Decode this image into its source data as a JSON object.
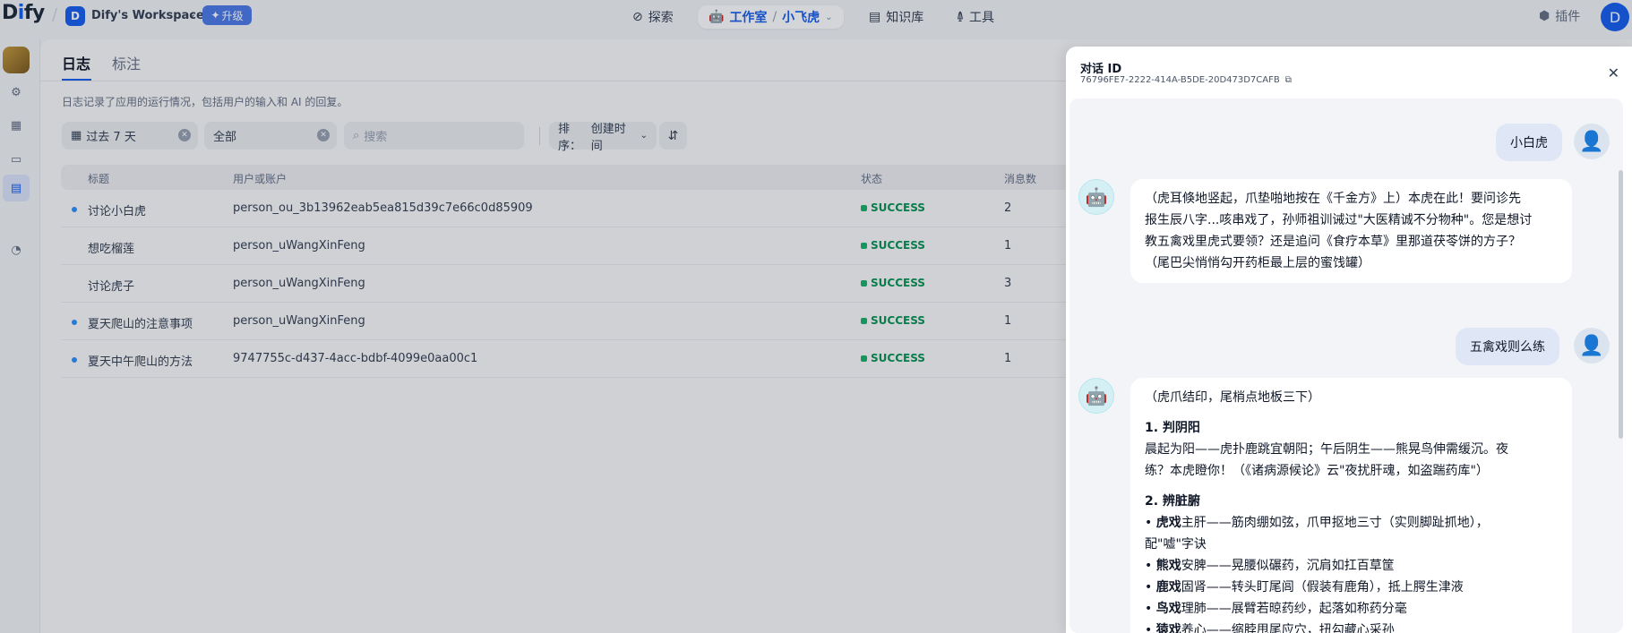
{
  "topbar": {
    "logo_prefix": "D",
    "logo_i": "i",
    "logo_suffix": "fy",
    "workspace_initial": "D",
    "workspace_name": "Dify's Workspace",
    "upgrade_label": "升级",
    "nav": {
      "explore": "探索",
      "studio": "工作室",
      "app": "小飞虎",
      "knowledge": "知识库",
      "tools": "工具"
    },
    "plugins": "插件",
    "user_initial": "D"
  },
  "main": {
    "tabs": [
      "日志",
      "标注"
    ],
    "description": "日志记录了应用的运行情况，包括用户的输入和 AI 的回复。",
    "filters": {
      "period": "过去 7 天",
      "status": "全部",
      "search_placeholder": "搜索",
      "sort_label": "排序：",
      "sort_value": "创建时间"
    },
    "columns": [
      "标题",
      "用户或账户",
      "状态",
      "消息数"
    ],
    "rows": [
      {
        "title": "讨论小白虎",
        "user": "person_ou_3b13962eab5ea815d39c7e66c0d85909",
        "status": "SUCCESS",
        "count": "2",
        "unread": true
      },
      {
        "title": "想吃榴莲",
        "user": "person_uWangXinFeng",
        "status": "SUCCESS",
        "count": "1",
        "unread": false
      },
      {
        "title": "讨论虎子",
        "user": "person_uWangXinFeng",
        "status": "SUCCESS",
        "count": "3",
        "unread": false
      },
      {
        "title": "夏天爬山的注意事项",
        "user": "person_uWangXinFeng",
        "status": "SUCCESS",
        "count": "1",
        "unread": true
      },
      {
        "title": "夏天中午爬山的方法",
        "user": "9747755c-d437-4acc-bdbf-4099e0aa00c1",
        "status": "SUCCESS",
        "count": "1",
        "unread": true
      }
    ]
  },
  "panel": {
    "title": "对话 ID",
    "conversation_id": "76796FE7-2222-414A-B5DE-20D473D7CAFB",
    "messages": {
      "user1": "小白虎",
      "bot1": [
        "（虎耳倏地竖起，爪垫啪地按在《千金方》上）本虎在此！要问诊先",
        "报生辰八字...咳串戏了，孙师祖训诫过\"大医精诚不分物种\"。您是想讨",
        "教五禽戏里虎式要领？还是追问《食疗本草》里那道茯苓饼的方子？",
        "（尾巴尖悄悄勾开药柜最上层的蜜饯罐）"
      ],
      "user2": "五禽戏则么练",
      "bot2": {
        "intro": "（虎爪结印，尾梢点地板三下）",
        "h1": "1. 判阴阳",
        "p1a": "晨起为阳——虎扑鹿跳宜朝阳；午后阴生——熊晃鸟伸需缓沉。夜",
        "p1b": "练？本虎瞪你！（《诸病源候论》云\"夜扰肝魂，如盗踹药库\"）",
        "h2": "2. 辨脏腑",
        "b1k": "虎戏",
        "b1v": "主肝——筋肉绷如弦，爪甲抠地三寸（实则脚趾抓地），",
        "b1c": "配\"嘘\"字诀",
        "b2k": "熊戏",
        "b2v": "安脾——晃腰似碾药，沉肩如扛百草筐",
        "b3k": "鹿戏",
        "b3v": "固肾——转头盯尾闾（假装有鹿角），抵上腭生津液",
        "b4k": "鸟戏",
        "b4v": "理肺——展臂若晾药纱，起落如称药分毫",
        "b5k": "猿戏",
        "b5v": "养心——缩脖甩尾应穴，扭勾藏心采孙"
      }
    }
  }
}
